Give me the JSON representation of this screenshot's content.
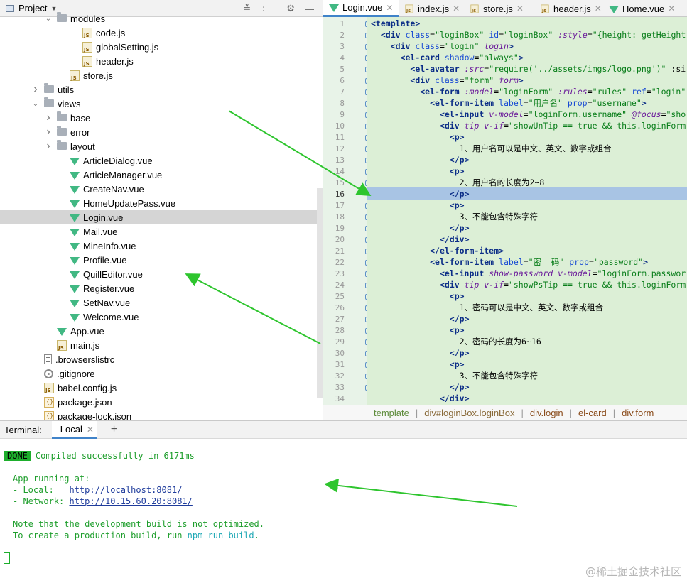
{
  "project_panel": {
    "title": "Project",
    "tree": [
      {
        "label": "modules",
        "type": "folder",
        "depth": 4,
        "arrow": "v"
      },
      {
        "label": "code.js",
        "type": "js",
        "depth": 6
      },
      {
        "label": "globalSetting.js",
        "type": "js",
        "depth": 6
      },
      {
        "label": "header.js",
        "type": "js",
        "depth": 6
      },
      {
        "label": "store.js",
        "type": "js",
        "depth": 5
      },
      {
        "label": "utils",
        "type": "folder",
        "depth": 3,
        "arrow": ">"
      },
      {
        "label": "views",
        "type": "folder",
        "depth": 3,
        "arrow": "v"
      },
      {
        "label": "base",
        "type": "folder",
        "depth": 4,
        "arrow": ">"
      },
      {
        "label": "error",
        "type": "folder",
        "depth": 4,
        "arrow": ">"
      },
      {
        "label": "layout",
        "type": "folder",
        "depth": 4,
        "arrow": ">"
      },
      {
        "label": "ArticleDialog.vue",
        "type": "vue",
        "depth": 5
      },
      {
        "label": "ArticleManager.vue",
        "type": "vue",
        "depth": 5
      },
      {
        "label": "CreateNav.vue",
        "type": "vue",
        "depth": 5
      },
      {
        "label": "HomeUpdatePass.vue",
        "type": "vue",
        "depth": 5
      },
      {
        "label": "Login.vue",
        "type": "vue",
        "depth": 5,
        "selected": true
      },
      {
        "label": "Mail.vue",
        "type": "vue",
        "depth": 5
      },
      {
        "label": "MineInfo.vue",
        "type": "vue",
        "depth": 5
      },
      {
        "label": "Profile.vue",
        "type": "vue",
        "depth": 5
      },
      {
        "label": "QuillEditor.vue",
        "type": "vue",
        "depth": 5
      },
      {
        "label": "Register.vue",
        "type": "vue",
        "depth": 5
      },
      {
        "label": "SetNav.vue",
        "type": "vue",
        "depth": 5
      },
      {
        "label": "Welcome.vue",
        "type": "vue",
        "depth": 5
      },
      {
        "label": "App.vue",
        "type": "vue",
        "depth": 4
      },
      {
        "label": "main.js",
        "type": "js",
        "depth": 4
      },
      {
        "label": ".browserslistrc",
        "type": "txt",
        "depth": 3
      },
      {
        "label": ".gitignore",
        "type": "git",
        "depth": 3
      },
      {
        "label": "babel.config.js",
        "type": "js",
        "depth": 3
      },
      {
        "label": "package.json",
        "type": "json",
        "depth": 3
      },
      {
        "label": "package-lock.json",
        "type": "json",
        "depth": 3
      }
    ]
  },
  "editor": {
    "tabs": [
      {
        "label": "Login.vue",
        "type": "vue",
        "active": true
      },
      {
        "label": "index.js",
        "type": "js"
      },
      {
        "label": "store.js",
        "type": "js"
      },
      {
        "label": "header.js",
        "type": "js"
      },
      {
        "label": "Home.vue",
        "type": "vue"
      }
    ],
    "line_numbers": [
      "1",
      "2",
      "3",
      "4",
      "5",
      "6",
      "7",
      "8",
      "9",
      "10",
      "11",
      "12",
      "13",
      "14",
      "15",
      "16",
      "17",
      "18",
      "19",
      "20",
      "21",
      "22",
      "23",
      "24",
      "25",
      "26",
      "27",
      "28",
      "29",
      "30",
      "31",
      "32",
      "33",
      "34"
    ],
    "current_line": "16",
    "code_lines": [
      "<template>",
      "  <div class=\"loginBox\" id=\"loginBox\" :style=\"{height: getHeight",
      "    <div class=\"login\" login>",
      "      <el-card shadow=\"always\">",
      "        <el-avatar :src=\"require('../assets/imgs/logo.png')\" :si",
      "        <div class=\"form\" form>",
      "          <el-form :model=\"loginForm\" :rules=\"rules\" ref=\"login\"",
      "            <el-form-item label=\"用户名\" prop=\"username\">",
      "              <el-input v-model=\"loginForm.username\" @focus=\"sho",
      "              <div tip v-if=\"showUnTip == true && this.loginForm",
      "                <p>",
      "                  1、用户名可以是中文、英文、数字或组合",
      "                </p>",
      "                <p>",
      "                  2、用户名的长度为2~8",
      "                </p>",
      "                <p>",
      "                  3、不能包含特殊字符",
      "                </p>",
      "              </div>",
      "            </el-form-item>",
      "            <el-form-item label=\"密  码\" prop=\"password\">",
      "              <el-input show-password v-model=\"loginForm.passwor",
      "              <div tip v-if=\"showPsTip == true && this.loginForm",
      "                <p>",
      "                  1、密码可以是中文、英文、数字或组合",
      "                </p>",
      "                <p>",
      "                  2、密码的长度为6~16",
      "                </p>",
      "                <p>",
      "                  3、不能包含特殊字符",
      "                </p>",
      "              </div>"
    ],
    "breadcrumb": [
      "template",
      "div#loginBox.loginBox",
      "div.login",
      "el-card",
      "div.form"
    ]
  },
  "terminal": {
    "label": "Terminal:",
    "tab": "Local",
    "badge": "DONE",
    "compiled": "Compiled successfully in 6171ms",
    "app_running": "App running at:",
    "local_label": "- Local:   ",
    "local_url": "http://localhost:8081/",
    "network_label": "- Network: ",
    "network_url": "http://10.15.60.20:8081/",
    "note1": "Note that the development build is not optimized.",
    "note2_pre": "To create a production build, run ",
    "note2_cmd": "npm run build",
    "note2_post": "."
  },
  "watermark": "@稀土掘金技术社区",
  "colors": {
    "accent": "#4083c9",
    "done_green": "#1dae2c",
    "annotation_arrow": "#2ec52e",
    "code_bg": "#dcefd6"
  }
}
